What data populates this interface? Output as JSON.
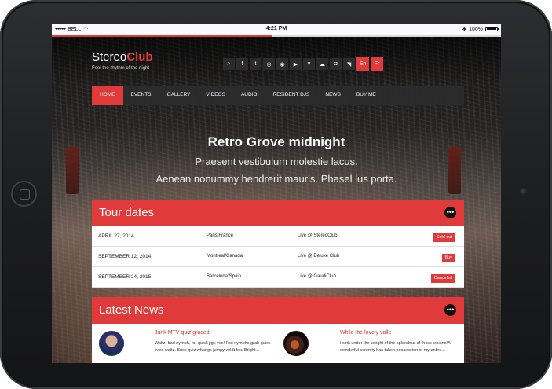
{
  "status_bar": {
    "carrier": "BELL",
    "time": "4:21 PM",
    "battery": "100%"
  },
  "page_load_progress": 0.49,
  "site": {
    "logo_part1": "Stereo",
    "logo_part2": "Club",
    "tagline": "Feel the rhythm of the night"
  },
  "social_icons": [
    {
      "name": "search",
      "glyph": "⌕"
    },
    {
      "name": "facebook",
      "glyph": "f"
    },
    {
      "name": "twitter",
      "glyph": "t"
    },
    {
      "name": "dribbble",
      "glyph": "◎"
    },
    {
      "name": "spotify",
      "glyph": "◉"
    },
    {
      "name": "youtube",
      "glyph": "▶"
    },
    {
      "name": "vimeo",
      "glyph": "v"
    },
    {
      "name": "soundcloud",
      "glyph": "☁"
    },
    {
      "name": "instagram",
      "glyph": "◘"
    },
    {
      "name": "rss",
      "glyph": "◥"
    }
  ],
  "languages": [
    "En",
    "Fr"
  ],
  "nav": [
    "HOME",
    "EVENTS",
    "GALLERY",
    "VIDEOS",
    "AUDIO",
    "RESIDENT DJS",
    "NEWS",
    "BUY ME"
  ],
  "nav_active": "HOME",
  "hero": {
    "title": "Retro Grove midnight",
    "line1": "Praesent vestibulum molestie lacus.",
    "line2": "Aenean nonummy hendrerit mauris. Phasel lus porta."
  },
  "tour": {
    "title": "Tour dates",
    "more": "•••",
    "rows": [
      {
        "date": "APRIL 27, 2014",
        "place": "Paris/France",
        "venue": "Live @ StereoClub",
        "action": "Sold out"
      },
      {
        "date": "SEPTEMBER 12, 2014",
        "place": "Montreal/Canada",
        "venue": "Live @ Deluxe Club",
        "action": "Buy"
      },
      {
        "date": "SEPTEMBER 24, 2015",
        "place": "Barcelona/Spain",
        "venue": "Live @ GaudiClub",
        "action": "Canceled"
      }
    ]
  },
  "news": {
    "title": "Latest News",
    "more": "•••",
    "items": [
      {
        "title": "Junk MTV quiz graced",
        "text": "Waltz, bad nymph, for quick jigs vex! Fox nymphs grab quick-jived waltz. Brick quiz whangs jumpy veldt fox. Bright..."
      },
      {
        "title": "While the lovely valle",
        "text": "I sink under the weight of the splendour of these visions!A wonderful serenity has taken possession of my entire..."
      }
    ]
  },
  "colors": {
    "accent": "#e03a3a",
    "nav_bg": "#2d2d2d",
    "frame": "#1c1d1f"
  }
}
